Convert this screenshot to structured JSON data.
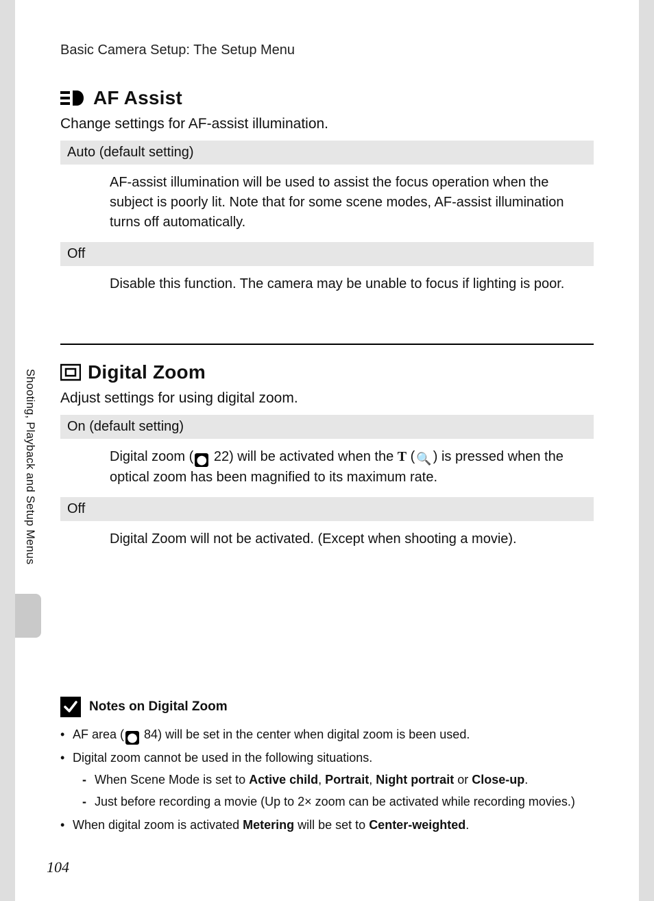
{
  "chapter": "Basic Camera Setup: The Setup Menu",
  "side_tab": "Shooting, Playback and Setup Menus",
  "page_number": "104",
  "sections": {
    "af": {
      "title": "AF Assist",
      "desc": "Change settings for AF-assist illumination.",
      "rows": {
        "r0": {
          "header": "Auto (default setting)",
          "body": "AF-assist illumination will be used to assist the focus operation when the subject is poorly lit. Note that for some scene modes, AF-assist illumination turns off automatically."
        },
        "r1": {
          "header": "Off",
          "body": "Disable this function. The camera may be unable to focus if lighting is poor."
        }
      }
    },
    "dz": {
      "title": "Digital Zoom",
      "desc": "Adjust settings for using digital zoom.",
      "rows": {
        "r0": {
          "header": "On (default setting)",
          "body_pre": "Digital zoom (",
          "ref": "22",
          "body_mid": ") will be activated when the ",
          "t": "T",
          "body_mid2": " (",
          "mag": "🔍",
          "body_post": ") is pressed when the optical zoom has been magnified to its maximum rate."
        },
        "r1": {
          "header": "Off",
          "body": "Digital Zoom will not be activated. (Except when shooting a movie)."
        }
      }
    }
  },
  "notes": {
    "title": "Notes on Digital Zoom",
    "n0": {
      "pre": "AF area (",
      "ref": "84",
      "post": ") will be set in the center when digital zoom is been used."
    },
    "n1": {
      "text": "Digital zoom cannot be used in the following situations.",
      "sub0": {
        "pre": "When Scene Mode is set to ",
        "b0": "Active child",
        "s0": ", ",
        "b1": "Portrait",
        "s1": ", ",
        "b2": "Night portrait",
        "s2": " or ",
        "b3": "Close-up",
        "post": "."
      },
      "sub1": "Just before recording a movie (Up to 2× zoom can be activated while recording movies.)"
    },
    "n2": {
      "pre": "When digital zoom is activated ",
      "b0": "Metering",
      "mid": " will be set to ",
      "b1": "Center-weighted",
      "post": "."
    }
  }
}
